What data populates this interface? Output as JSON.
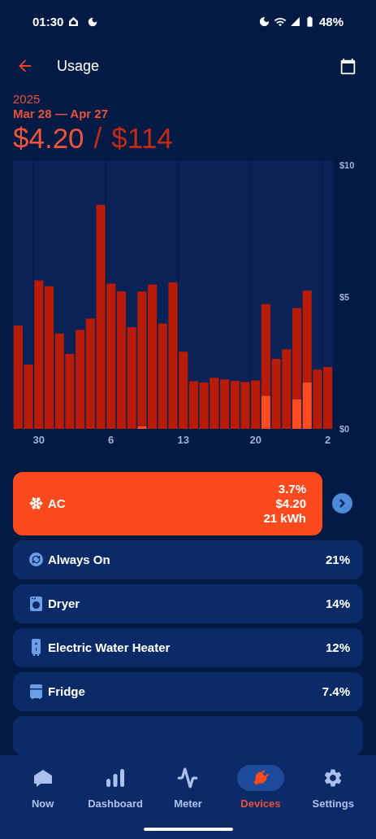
{
  "status_bar": {
    "time": "01:30",
    "battery": "48%"
  },
  "header": {
    "title": "Usage"
  },
  "summary": {
    "year": "2025",
    "range": "Mar 28 — Apr 27",
    "amount": "$4.20",
    "separator": "/",
    "total": "$114"
  },
  "chart": {
    "chart_data": {
      "type": "bar",
      "stacked": true,
      "categories": [
        null,
        null,
        "30",
        null,
        null,
        null,
        null,
        null,
        null,
        "6",
        null,
        null,
        null,
        null,
        null,
        null,
        "13",
        null,
        null,
        null,
        null,
        null,
        null,
        "20",
        null,
        null,
        null,
        null,
        null,
        null,
        "2"
      ],
      "series": [
        {
          "color": "#ff4b1f",
          "values": [
            0,
            0,
            0,
            0,
            0,
            0,
            0,
            0,
            0,
            0,
            0,
            0,
            0.1,
            0,
            0,
            0,
            0,
            0,
            0,
            0,
            0,
            0,
            0,
            0,
            1.26,
            0,
            0,
            1.13,
            1.76,
            0,
            0
          ]
        },
        {
          "color": "#b81c08",
          "values": [
            3.92,
            2.44,
            5.64,
            5.42,
            3.62,
            2.85,
            3.76,
            4.19,
            8.51,
            5.52,
            5.22,
            3.86,
            5.12,
            5.48,
            4.0,
            5.56,
            2.93,
            1.81,
            1.76,
            1.94,
            1.88,
            1.82,
            1.78,
            1.84,
            3.48,
            2.66,
            3.02,
            3.46,
            3.49,
            2.25,
            2.35
          ]
        }
      ],
      "ylim": [
        0,
        10.2
      ],
      "yticks": [
        {
          "value": 0,
          "label": "$0"
        },
        {
          "value": 5,
          "label": "$5"
        },
        {
          "value": 10,
          "label": "$10"
        }
      ]
    }
  },
  "devices": [
    {
      "name": "AC",
      "share": "3.7%",
      "cost": "$4.20",
      "energy": "21 kWh",
      "selected": true
    },
    {
      "name": "Always On",
      "share": "21%",
      "selected": false
    },
    {
      "name": "Dryer",
      "share": "14%",
      "selected": false
    },
    {
      "name": "Electric Water Heater",
      "share": "12%",
      "selected": false
    },
    {
      "name": "Fridge",
      "share": "7.4%",
      "selected": false
    }
  ],
  "bottom_nav": [
    {
      "label": "Now",
      "selected": false
    },
    {
      "label": "Dashboard",
      "selected": false
    },
    {
      "label": "Meter",
      "selected": false
    },
    {
      "label": "Devices",
      "selected": true
    },
    {
      "label": "Settings",
      "selected": false
    }
  ]
}
